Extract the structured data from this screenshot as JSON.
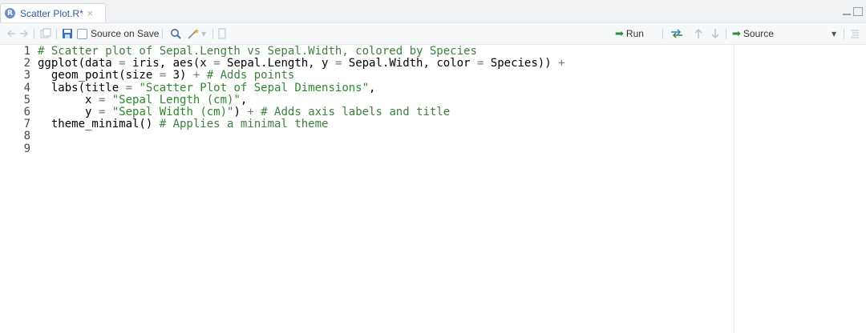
{
  "tab": {
    "icon": "R",
    "title": "Scatter Plot.R*",
    "close": "×"
  },
  "toolbar": {
    "source_on_save": "Source on Save",
    "run": "Run",
    "source": "Source"
  },
  "editor": {
    "lines": [
      {
        "num": "1",
        "indent": "",
        "parts": [
          {
            "t": "# Scatter plot of Sepal.Length vs Sepal.Width, colored by Species",
            "c": "cm"
          }
        ]
      },
      {
        "num": "2",
        "indent": "",
        "parts": [
          {
            "t": "ggplot(data ",
            "c": ""
          },
          {
            "t": "=",
            "c": "op"
          },
          {
            "t": " iris, aes(x ",
            "c": ""
          },
          {
            "t": "=",
            "c": "op"
          },
          {
            "t": " Sepal.Length, y ",
            "c": ""
          },
          {
            "t": "=",
            "c": "op"
          },
          {
            "t": " Sepal.Width, color ",
            "c": ""
          },
          {
            "t": "=",
            "c": "op"
          },
          {
            "t": " Species)) ",
            "c": ""
          },
          {
            "t": "+",
            "c": "op"
          }
        ]
      },
      {
        "num": "3",
        "indent": "  ",
        "parts": [
          {
            "t": "geom_point(size ",
            "c": ""
          },
          {
            "t": "=",
            "c": "op"
          },
          {
            "t": " 3) ",
            "c": ""
          },
          {
            "t": "+",
            "c": "op"
          },
          {
            "t": " # Adds points",
            "c": "cm"
          }
        ]
      },
      {
        "num": "4",
        "indent": "  ",
        "parts": [
          {
            "t": "labs(title ",
            "c": ""
          },
          {
            "t": "=",
            "c": "op"
          },
          {
            "t": " ",
            "c": ""
          },
          {
            "t": "\"Scatter Plot of Sepal Dimensions\"",
            "c": "str"
          },
          {
            "t": ",",
            "c": ""
          }
        ]
      },
      {
        "num": "5",
        "indent": "       ",
        "parts": [
          {
            "t": "x ",
            "c": ""
          },
          {
            "t": "=",
            "c": "op"
          },
          {
            "t": " ",
            "c": ""
          },
          {
            "t": "\"Sepal Length (cm)\"",
            "c": "str"
          },
          {
            "t": ",",
            "c": ""
          }
        ]
      },
      {
        "num": "6",
        "indent": "       ",
        "parts": [
          {
            "t": "y ",
            "c": ""
          },
          {
            "t": "=",
            "c": "op"
          },
          {
            "t": " ",
            "c": ""
          },
          {
            "t": "\"Sepal Width (cm)\"",
            "c": "str"
          },
          {
            "t": ") ",
            "c": ""
          },
          {
            "t": "+",
            "c": "op"
          },
          {
            "t": " # Adds axis labels and title",
            "c": "cm"
          }
        ]
      },
      {
        "num": "7",
        "indent": "  ",
        "parts": [
          {
            "t": "theme_minimal() ",
            "c": ""
          },
          {
            "t": "# Applies a minimal theme",
            "c": "cm"
          }
        ]
      },
      {
        "num": "8",
        "indent": "",
        "parts": []
      },
      {
        "num": "9",
        "indent": "",
        "parts": []
      }
    ]
  },
  "colors": {
    "comment": "#3d7f3d",
    "string": "#2a8a2a",
    "tab_title": "#2e5aa8",
    "run_arrow": "#2e8b3c"
  },
  "icons": [
    "r-file-icon",
    "back-arrow-icon",
    "forward-arrow-icon",
    "show-in-window-icon",
    "save-icon",
    "search-icon",
    "code-tools-icon",
    "compile-report-icon",
    "run-arrow-icon",
    "rerun-icon",
    "go-up-icon",
    "go-down-icon",
    "source-icon",
    "outline-icon"
  ]
}
